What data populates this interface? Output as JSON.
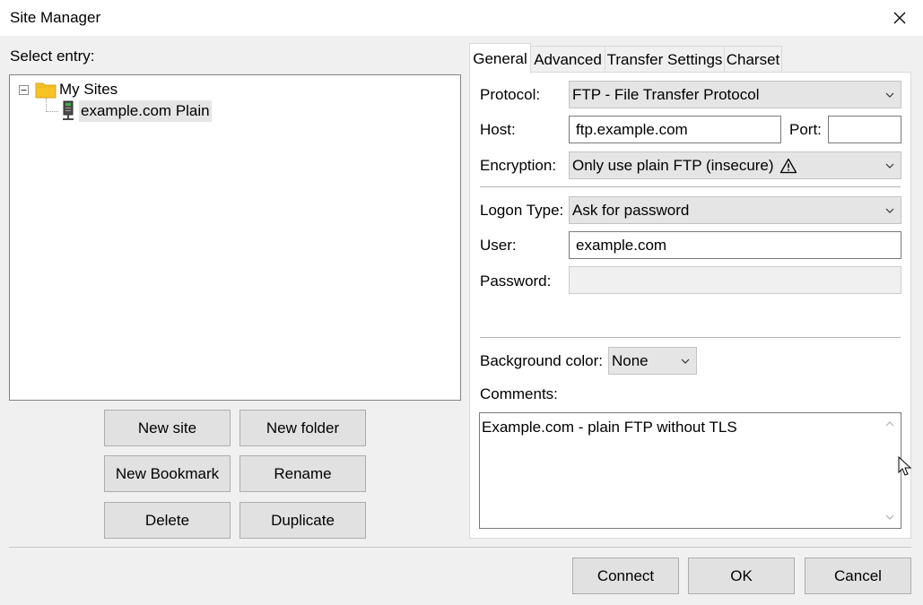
{
  "window": {
    "title": "Site Manager"
  },
  "left": {
    "select_entry_label": "Select entry:",
    "tree": {
      "root_label": "My Sites",
      "root_expander": "⊟",
      "site_label": "example.com Plain"
    },
    "buttons": {
      "new_site": "New site",
      "new_folder": "New folder",
      "new_bookmark": "New Bookmark",
      "rename": "Rename",
      "delete": "Delete",
      "duplicate": "Duplicate"
    }
  },
  "tabs": [
    {
      "label": "General",
      "active": true
    },
    {
      "label": "Advanced"
    },
    {
      "label": "Transfer Settings"
    },
    {
      "label": "Charset"
    }
  ],
  "general": {
    "protocol_label": "Protocol:",
    "protocol_value": "FTP - File Transfer Protocol",
    "host_label": "Host:",
    "host_value": "ftp.example.com",
    "port_label": "Port:",
    "port_value": "",
    "encryption_label": "Encryption:",
    "encryption_value": "Only use plain FTP (insecure)",
    "logon_type_label": "Logon Type:",
    "logon_type_value": "Ask for password",
    "user_label": "User:",
    "user_value": "example.com",
    "password_label": "Password:",
    "background_color_label": "Background color:",
    "background_color_value": "None",
    "comments_label": "Comments:",
    "comments_value": "Example.com - plain FTP without TLS"
  },
  "footer": {
    "connect": "Connect",
    "ok": "OK",
    "cancel": "Cancel"
  },
  "colors": {
    "folder": "#f7c325",
    "button_bg": "#e1e1e1",
    "dialog_bg": "#f0f0f0",
    "disabled_field": "#f0f0f0"
  },
  "icons": {
    "close": "close-icon",
    "folder": "folder-icon",
    "site": "server-icon",
    "warning": "warning-icon",
    "chevron": "chevron-down-icon",
    "cursor": "mouse-cursor-icon"
  }
}
